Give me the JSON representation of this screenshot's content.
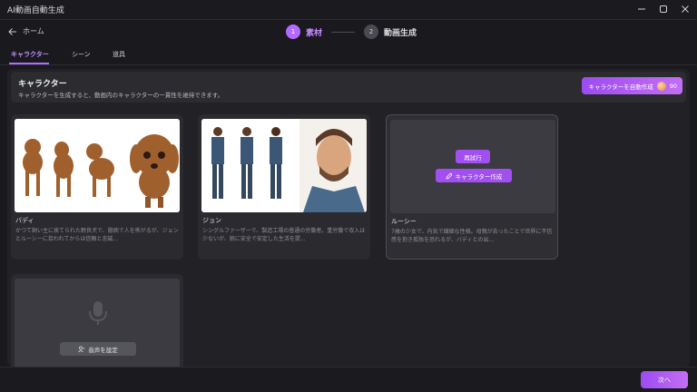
{
  "window": {
    "title": "AI動画自動生成"
  },
  "nav": {
    "back_label": "ホーム",
    "steps": [
      {
        "num": "1",
        "label": "素材",
        "active": true
      },
      {
        "num": "2",
        "label": "動画生成",
        "active": false
      }
    ]
  },
  "tabs": [
    {
      "label": "キャラクター",
      "active": true
    },
    {
      "label": "シーン",
      "active": false
    },
    {
      "label": "道具",
      "active": false
    }
  ],
  "header": {
    "title": "キャラクター",
    "description": "キャラクターを生成すると、動画内のキャラクターの一貫性を維持できます。",
    "auto_button_label": "キャラクターを自動作成",
    "credits": "90"
  },
  "characters": [
    {
      "name": "バディ",
      "description": "かつて飼い主に捨てられた野良犬で、臆病で人を怖がるが、ジョンとルーシーに拾われてからは信頼と忠誠..."
    },
    {
      "name": "ジョン",
      "description": "シングルファーザーで、製造工場の普通の労働者。重労働で収入は少ないが、娘に安全で安定した生活を提..."
    },
    {
      "name": "ルーシー",
      "description": "7歳の少女で、内気で繊細な性格。母親が去ったことで世界に不信感を抱き孤独を恐れるが、バディとの出...",
      "retry_label": "再試行",
      "create_label": "キャラクター作成"
    }
  ],
  "voice": {
    "button_label": "音声を設定"
  },
  "footer": {
    "next_label": "次へ"
  },
  "colors": {
    "accent": "#b36bff",
    "background": "#1a1a1e",
    "card": "#2a2a2f"
  }
}
